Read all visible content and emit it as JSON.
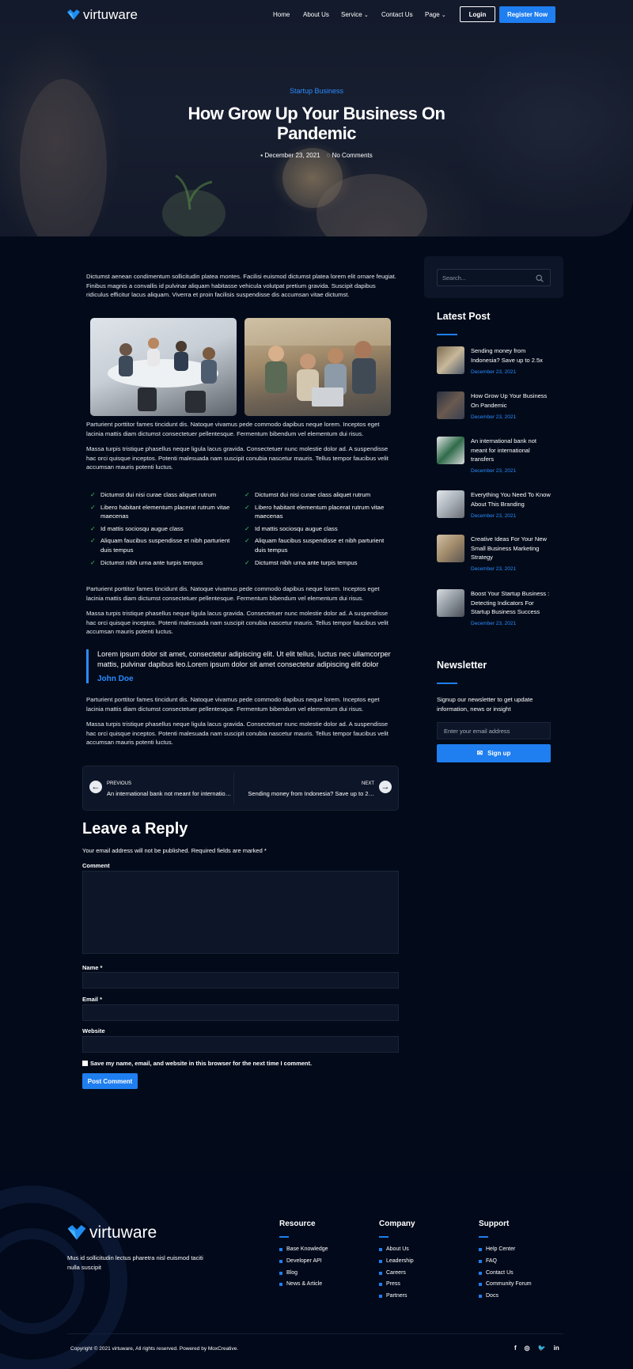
{
  "brand": {
    "name": "virtuware",
    "accent": "#1f7ef0"
  },
  "nav": {
    "items": [
      "Home",
      "About Us",
      "Service",
      "Contact Us",
      "Page"
    ],
    "login": "Login",
    "register": "Register Now"
  },
  "hero": {
    "category": "Startup Business",
    "title": "How Grow Up Your Business On Pandemic",
    "date": "December 23, 2021",
    "comments": "No Comments"
  },
  "article": {
    "intro": "Dictumst aenean condimentum sollicitudin platea montes. Facilisi euismod dictumst platea lorem elit ornare feugiat. Finibus magnis a convallis id pulvinar aliquam habitasse vehicula volutpat pretium gravida. Suscipit dapibus ridiculus efficitur lacus aliquam. Viverra et proin facilisis suspendisse dis accumsan vitae dictumst.",
    "p1": "Parturient porttitor fames tincidunt dis. Natoque vivamus pede commodo dapibus neque lorem. Inceptos eget lacinia mattis diam dictumst consectetuer pellentesque. Fermentum bibendum vel elementum dui risus.",
    "p2": "Massa turpis tristique phasellus neque ligula lacus gravida. Consectetuer nunc molestie dolor ad. A suspendisse hac orci quisque inceptos. Potenti malesuada nam suscipit conubia nascetur mauris. Tellus tempor faucibus velit accumsan mauris potenti luctus.",
    "checks_left": [
      "Dictumst dui nisi curae class aliquet rutrum",
      "Libero habitant elementum placerat rutrum vitae maecenas",
      "Id mattis sociosqu augue class",
      "Aliquam faucibus suspendisse et nibh parturient duis tempus",
      "Dictumst nibh urna ante turpis tempus"
    ],
    "checks_right": [
      "Dictumst dui nisi curae class aliquet rutrum",
      "Libero habitant elementum placerat rutrum vitae maecenas",
      "Id mattis sociosqu augue class",
      "Aliquam faucibus suspendisse et nibh parturient duis tempus",
      "Dictumst nibh urna ante turpis tempus"
    ],
    "p3": "Parturient porttitor fames tincidunt dis. Natoque vivamus pede commodo dapibus neque lorem. Inceptos eget lacinia mattis diam dictumst consectetuer pellentesque. Fermentum bibendum vel elementum dui risus.",
    "p4": "Massa turpis tristique phasellus neque ligula lacus gravida. Consectetuer nunc molestie dolor ad. A suspendisse hac orci quisque inceptos. Potenti malesuada nam suscipit conubia nascetur mauris. Tellus tempor faucibus velit accumsan mauris potenti luctus.",
    "quote": "Lorem ipsum dolor sit amet, consectetur adipiscing elit. Ut elit tellus, luctus nec ullamcorper mattis, pulvinar dapibus leo.Lorem ipsum dolor sit amet consectetur adipiscing elit dolor",
    "quote_author": "John Doe",
    "p5": "Parturient porttitor fames tincidunt dis. Natoque vivamus pede commodo dapibus neque lorem. Inceptos eget lacinia mattis diam dictumst consectetuer pellentesque. Fermentum bibendum vel elementum dui risus.",
    "p6": "Massa turpis tristique phasellus neque ligula lacus gravida. Consectetuer nunc molestie dolor ad. A suspendisse hac orci quisque inceptos. Potenti malesuada nam suscipit conubia nascetur mauris. Tellus tempor faucibus velit accumsan mauris potenti luctus."
  },
  "postnav": {
    "prev_label": "PREVIOUS",
    "prev_title": "An international bank not meant for internatio…",
    "next_label": "NEXT",
    "next_title": "Sending money from Indonesia? Save up to 2…"
  },
  "reply": {
    "heading": "Leave a Reply",
    "note": "Your email address will not be published. Required fields are marked *",
    "comment_label": "Comment",
    "name_label": "Name *",
    "email_label": "Email *",
    "website_label": "Website",
    "save_label": "Save my name, email, and website in this browser for the next time I comment.",
    "submit": "Post Comment"
  },
  "sidebar": {
    "search_placeholder": "Search...",
    "latest_heading": "Latest Post",
    "posts": [
      {
        "title": "Sending money from Indonesia? Save up to 2.5x",
        "date": "December 23, 2021"
      },
      {
        "title": "How Grow Up Your Business On Pandemic",
        "date": "December 23, 2021"
      },
      {
        "title": "An international bank not meant for international transfers",
        "date": "December 23, 2021"
      },
      {
        "title": "Everything You Need To Know About This Branding",
        "date": "December 23, 2021"
      },
      {
        "title": "Creative Ideas For Your New Small Business Marketing Strategy",
        "date": "December 23, 2021"
      },
      {
        "title": "Boost Your Startup Business : Detecting Indicators For Startup Business Success",
        "date": "December 23, 2021"
      }
    ],
    "newsletter_heading": "Newsletter",
    "newsletter_text": "Signup our newsletter to get update information, news or insight",
    "newsletter_placeholder": "Enter your email address",
    "newsletter_button": "Sign up"
  },
  "footer": {
    "about": "Mus id sollicitudin lectus pharetra nisl euismod taciti nulla suscipit",
    "resource": {
      "heading": "Resource",
      "links": [
        "Base Knowledge",
        "Developer API",
        "Blog",
        "News & Article"
      ]
    },
    "company": {
      "heading": "Company",
      "links": [
        "About Us",
        "Leadership",
        "Careers",
        "Press",
        "Partners"
      ]
    },
    "support": {
      "heading": "Support",
      "links": [
        "Help Center",
        "FAQ",
        "Contact Us",
        "Community Forum",
        "Docs"
      ]
    },
    "copyright": "Copyright © 2021 virtuware, All rights reserved. Powered by MoxCreative.",
    "social": [
      "facebook-icon",
      "instagram-icon",
      "twitter-icon",
      "linkedin-icon"
    ]
  }
}
